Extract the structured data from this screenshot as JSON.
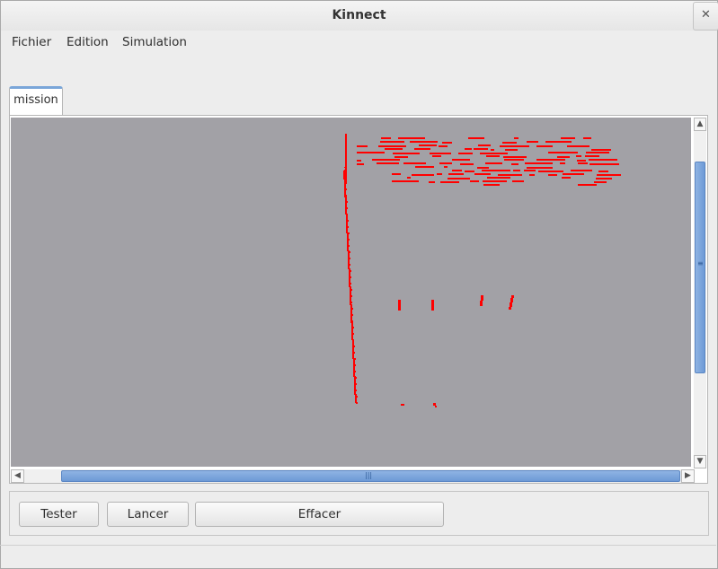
{
  "window": {
    "title": "Kinnect",
    "close_glyph": "✕"
  },
  "menubar": {
    "items": [
      "Fichier",
      "Edition",
      "Simulation"
    ]
  },
  "tabs": [
    {
      "label": "mission",
      "active": true
    }
  ],
  "canvas": {
    "background": "#a2a1a6",
    "point_color": "#ff0000"
  },
  "buttons": {
    "test_label": "Tester",
    "launch_label": "Lancer",
    "clear_label": "Effacer"
  },
  "icons": {
    "scroll_up": "chevron-up-icon",
    "scroll_down": "chevron-down-icon",
    "scroll_left": "chevron-left-icon",
    "scroll_right": "chevron-right-icon"
  },
  "accent_color": "#7aa6d9"
}
